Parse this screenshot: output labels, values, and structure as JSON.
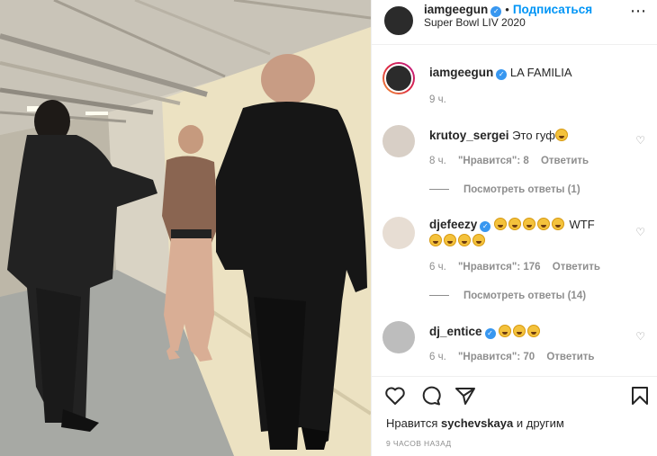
{
  "header": {
    "username": "iamgeegun",
    "follow_label": "Подписаться",
    "location": "Super Bowl LIV 2020",
    "more_label": "⋯"
  },
  "caption": {
    "username": "iamgeegun",
    "text": "LA FAMILIA",
    "time": "9 ч."
  },
  "comments": [
    {
      "username": "krutoy_sergei",
      "verified": false,
      "text": "Это гуф",
      "emoji_count": 1,
      "time": "8 ч.",
      "likes": "\"Нравится\": 8",
      "reply_label": "Ответить",
      "view_replies": "Посмотреть ответы (1)"
    },
    {
      "username": "djefeezy",
      "verified": true,
      "text": "WTF",
      "emoji_count_before": 5,
      "emoji_count_after": 4,
      "time": "6 ч.",
      "likes": "\"Нравится\": 176",
      "reply_label": "Ответить",
      "view_replies": "Посмотреть ответы (14)"
    },
    {
      "username": "dj_entice",
      "verified": true,
      "text": "",
      "emoji_count": 3,
      "time": "6 ч.",
      "likes": "\"Нравится\": 70",
      "reply_label": "Ответить"
    }
  ],
  "footer": {
    "liked_prefix": "Нравится",
    "liked_user": "sychevskaya",
    "liked_suffix": "и другим",
    "time_ago": "9 часов назад"
  },
  "colors": {
    "accent": "#0095f6",
    "verified": "#3897f0",
    "muted": "#8e8e8e",
    "text": "#262626"
  },
  "icons": [
    "more-icon",
    "verified-icon",
    "heart-icon",
    "comment-icon",
    "share-icon",
    "bookmark-icon"
  ]
}
